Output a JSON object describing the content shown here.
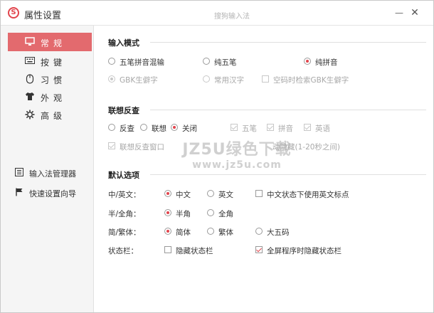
{
  "window": {
    "title": "属性设置",
    "product_name": "搜狗输入法",
    "logo_text": "S",
    "minimize_glyph": "—",
    "close_glyph": "✕",
    "accent_color": "#e2444c",
    "active_nav_color": "#e36a6e"
  },
  "sidebar": {
    "items": [
      {
        "label": "常规",
        "icon": "monitor-icon",
        "active": true
      },
      {
        "label": "按键",
        "icon": "keyboard-icon",
        "active": false
      },
      {
        "label": "习惯",
        "icon": "mouse-icon",
        "active": false
      },
      {
        "label": "外观",
        "icon": "tshirt-icon",
        "active": false
      },
      {
        "label": "高级",
        "icon": "gear-icon",
        "active": false
      }
    ],
    "tools": [
      {
        "label": "输入法管理器",
        "icon": "list-icon"
      },
      {
        "label": "快速设置向导",
        "icon": "flag-icon"
      }
    ]
  },
  "input_mode": {
    "title": "输入模式",
    "options": [
      "五笔拼音混输",
      "纯五笔",
      "纯拼音"
    ],
    "selected": "纯拼音",
    "sub_options": [
      "GBK生僻字",
      "常用汉字"
    ],
    "sub_selected": "GBK生僻字",
    "check_label": "空码时检索GBK生僻字"
  },
  "reverse_lookup": {
    "title": "联想反查",
    "options": [
      "反查",
      "联想",
      "关闭"
    ],
    "selected": "关闭",
    "checks": [
      "五笔",
      "拼音",
      "英语"
    ],
    "window_option_visible": "联想反查窗口",
    "window_option_tail": "动隐藏(1-20秒之间)"
  },
  "defaults": {
    "title": "默认选项",
    "rows": [
      {
        "label": "中/英文：",
        "options": [
          "中文",
          "英文"
        ],
        "selected": "中文",
        "check": "中文状态下使用英文标点",
        "check_on": false
      },
      {
        "label": "半/全角：",
        "options": [
          "半角",
          "全角"
        ],
        "selected": "半角"
      },
      {
        "label": "简/繁体：",
        "options": [
          "简体",
          "繁体",
          "大五码"
        ],
        "selected": "简体"
      },
      {
        "label": "状态栏：",
        "checks": [
          {
            "label": "隐藏状态栏",
            "on": false
          },
          {
            "label": "全屏程序时隐藏状态栏",
            "on": true
          }
        ]
      }
    ]
  },
  "watermark": {
    "line1": "JZ5U绿色下载",
    "line2": "www.jz5u.com"
  }
}
